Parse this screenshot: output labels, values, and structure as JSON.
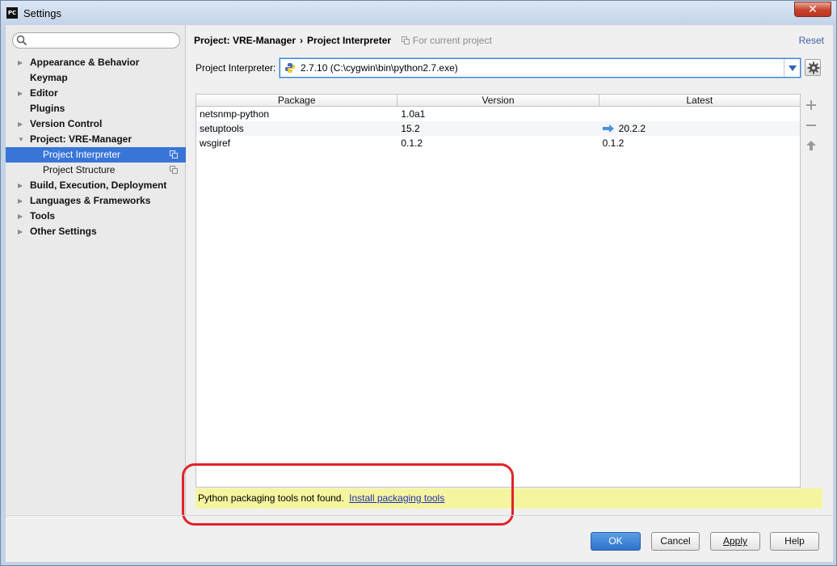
{
  "window": {
    "title": "Settings",
    "app_icon_text": "PC",
    "close_glyph": "✕"
  },
  "search": {
    "placeholder": "",
    "value": ""
  },
  "sidebar": {
    "items": [
      {
        "label": "Appearance & Behavior",
        "expandable": true
      },
      {
        "label": "Keymap",
        "expandable": false
      },
      {
        "label": "Editor",
        "expandable": true
      },
      {
        "label": "Plugins",
        "expandable": false
      },
      {
        "label": "Version Control",
        "expandable": true
      },
      {
        "label": "Project: VRE-Manager",
        "expandable": true,
        "expanded": true
      },
      {
        "label": "Project Interpreter",
        "child": true,
        "selected": true
      },
      {
        "label": "Project Structure",
        "child": true
      },
      {
        "label": "Build, Execution, Deployment",
        "expandable": true
      },
      {
        "label": "Languages & Frameworks",
        "expandable": true
      },
      {
        "label": "Tools",
        "expandable": true
      },
      {
        "label": "Other Settings",
        "expandable": true
      }
    ]
  },
  "header": {
    "crumb_project": "Project: VRE-Manager",
    "crumb_sep": "›",
    "crumb_page": "Project Interpreter",
    "scope_note": "For current project",
    "reset_label": "Reset"
  },
  "interpreter": {
    "label": "Project Interpreter:",
    "value": "2.7.10 (C:\\cygwin\\bin\\python2.7.exe)"
  },
  "packages": {
    "columns": [
      "Package",
      "Version",
      "Latest"
    ],
    "rows": [
      {
        "package": "netsnmp-python",
        "version": "1.0a1",
        "latest": "",
        "upgrade": false
      },
      {
        "package": "setuptools",
        "version": "15.2",
        "latest": "20.2.2",
        "upgrade": true
      },
      {
        "package": "wsgiref",
        "version": "0.1.2",
        "latest": "0.1.2",
        "upgrade": false
      }
    ]
  },
  "warning": {
    "text": "Python packaging tools not found.",
    "link": "Install packaging tools"
  },
  "buttons": {
    "ok": "OK",
    "cancel": "Cancel",
    "apply": "Apply",
    "help": "Help"
  },
  "colors": {
    "selection": "#3875d7",
    "warning_bg": "#f5f5a0",
    "annotation": "#e0242b",
    "ok_button": "#2d73cc"
  }
}
